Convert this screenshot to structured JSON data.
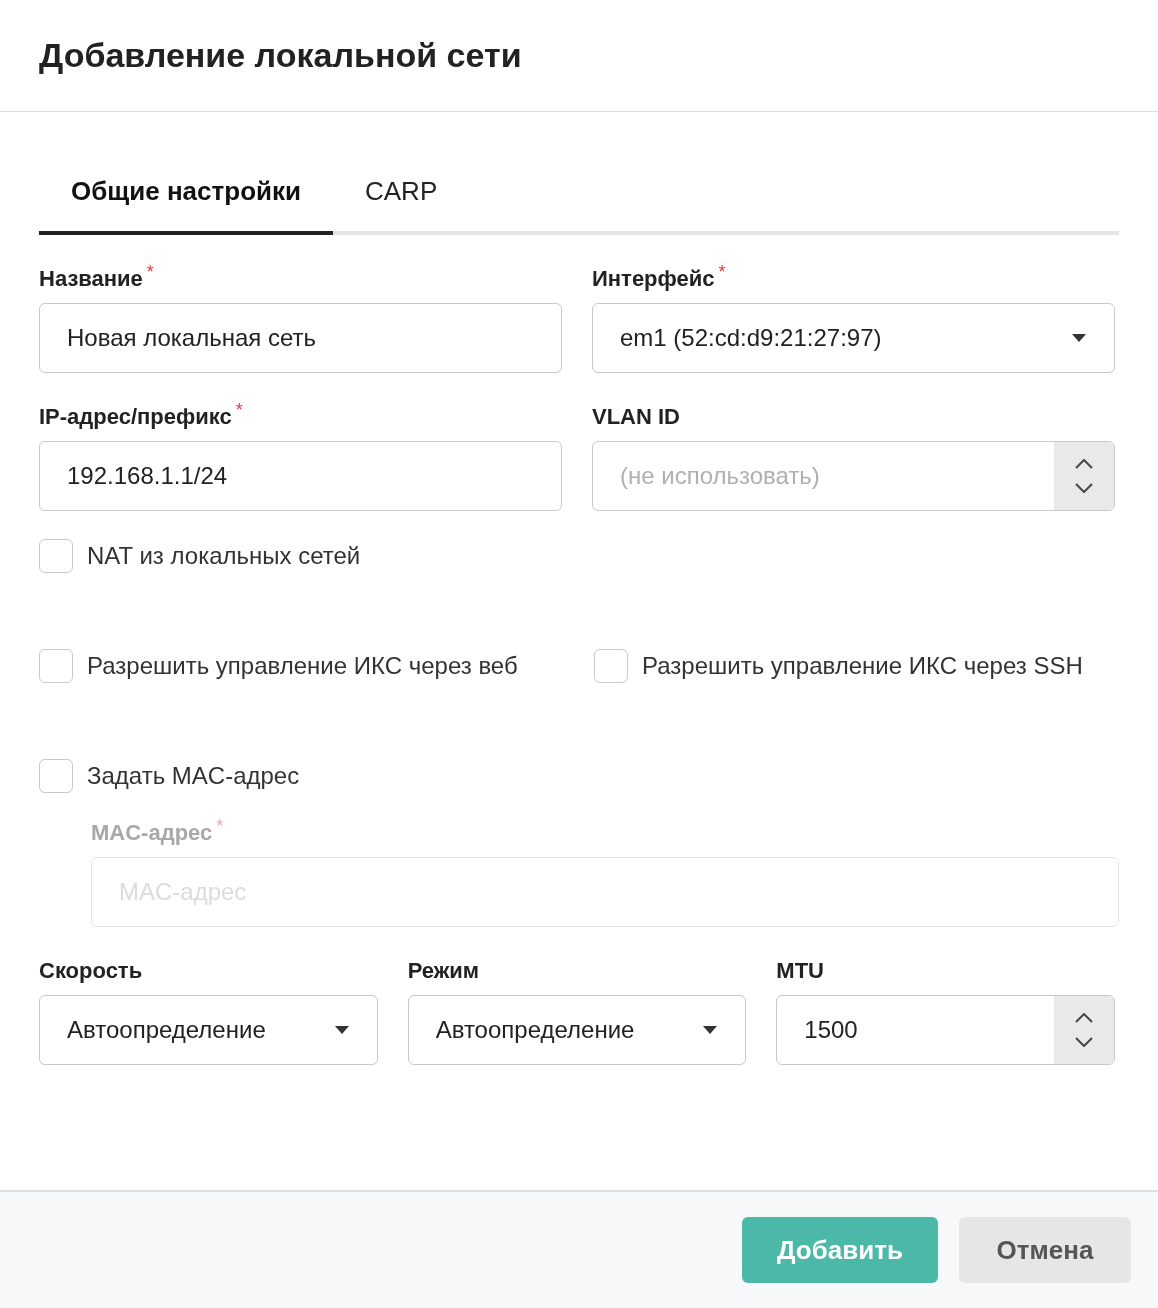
{
  "dialog": {
    "title": "Добавление локальной сети"
  },
  "tabs": [
    {
      "label": "Общие настройки",
      "selected": true
    },
    {
      "label": "CARP",
      "selected": false
    }
  ],
  "sections": [
    {
      "kind": "fields",
      "fields": [
        {
          "kind": "text",
          "label": "Название",
          "required_mark": "*",
          "value": "Новая локальная сеть"
        },
        {
          "kind": "select",
          "label": "Интерфейс",
          "required_mark": "*",
          "value": "em1 (52:cd:d9:21:27:97)"
        }
      ]
    },
    {
      "kind": "fields",
      "fields": [
        {
          "kind": "text",
          "label": "IP-адрес/префикс",
          "required_mark": "*",
          "value": "192.168.1.1/24"
        },
        {
          "kind": "number",
          "label": "VLAN ID",
          "placeholder": "(не использовать)"
        }
      ]
    },
    {
      "kind": "checkboxes",
      "items": [
        {
          "label": "NAT из локальных сетей",
          "checked": false
        }
      ]
    },
    {
      "kind": "checkboxes",
      "items": [
        {
          "label": "Разрешить управление ИКС через веб",
          "checked": false
        },
        {
          "label": "Разрешить управление ИКС через SSH",
          "checked": false
        }
      ]
    },
    {
      "kind": "checkboxes",
      "items": [
        {
          "label": "Задать MAC-адрес",
          "checked": false,
          "field": {
            "kind": "text",
            "label": "MAC-адрес",
            "required_mark": "*",
            "disabled": true,
            "placeholder": "MAC-адрес"
          }
        }
      ]
    },
    {
      "kind": "fields",
      "fields": [
        {
          "kind": "select",
          "label": "Скорость",
          "value": "Автоопределение"
        },
        {
          "kind": "select",
          "label": "Режим",
          "value": "Автоопределение"
        },
        {
          "kind": "number",
          "label": "MTU",
          "value": "1500"
        }
      ]
    }
  ],
  "buttons": [
    {
      "kind": "primary",
      "label": "Добавить"
    },
    {
      "kind": "secondary",
      "label": "Отмена"
    }
  ]
}
